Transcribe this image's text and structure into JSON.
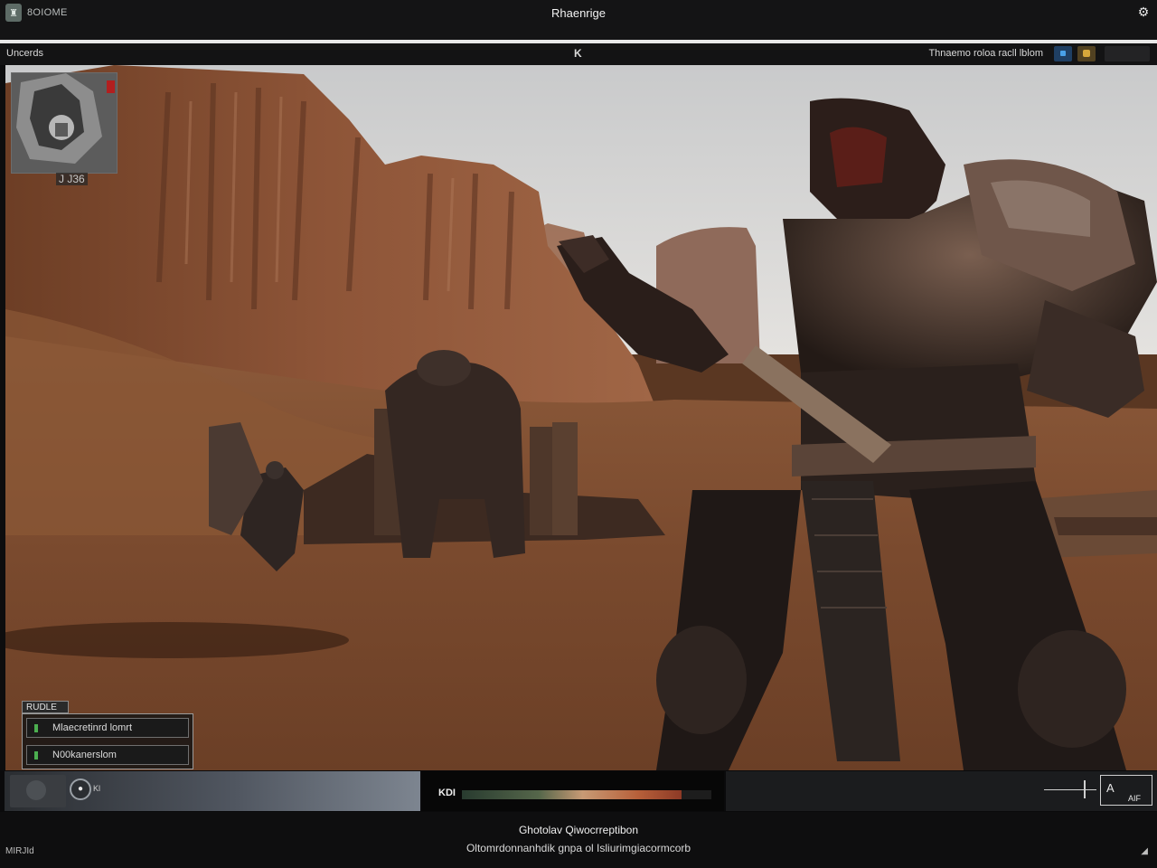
{
  "window": {
    "app_name": "8OIOME",
    "title": "Rhaenrige",
    "logo_glyph": "♜"
  },
  "toolbar": {
    "left_label": "Uncerds",
    "center_label": "K",
    "right_label": "Thnaemo roloa racll lblom"
  },
  "minimap": {
    "label": "J J36"
  },
  "log": {
    "tab_label": "RUDLE",
    "rows": [
      {
        "text": "Mlaecretinrd lomrt"
      },
      {
        "text": "N00kanerslom"
      }
    ]
  },
  "hud": {
    "slot_glyph": "●",
    "slot_label": "Kl",
    "health_label": "KDI",
    "health_fraction": 0.88,
    "right_box_label": "A",
    "right_box_sub": "AIF"
  },
  "footer": {
    "line1": "Ghotolav Qiwocrreptibon",
    "line2": "Oltomrdonnanhdik gnpa ol Isliurimgiacormcorb",
    "corner_left": "MIRJId",
    "corner_right": "◢"
  },
  "colors": {
    "sky": "#d9dadb",
    "canyon": "#8a5236",
    "sand": "#7b4a2e",
    "armor": "#2b201c",
    "accent_blue": "#49a1e8",
    "accent_gold": "#d6a73b"
  }
}
